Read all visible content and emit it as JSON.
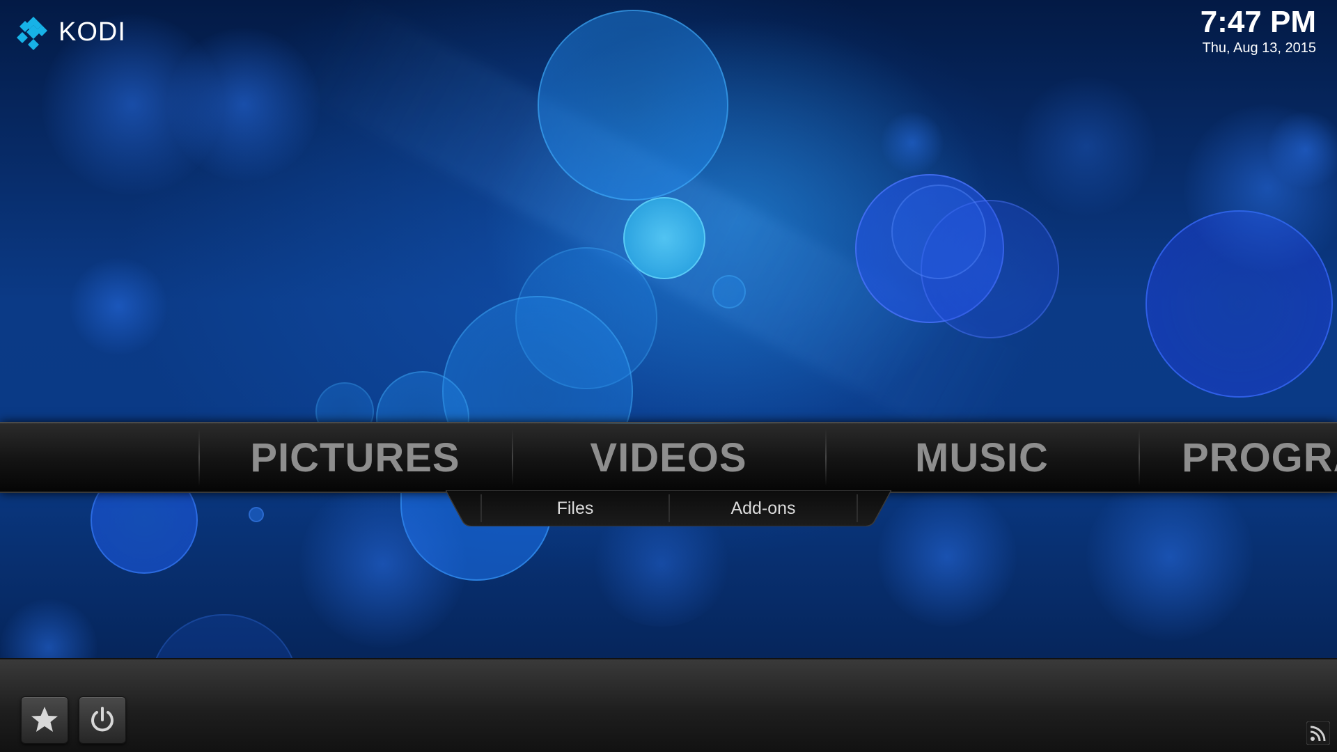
{
  "app": {
    "name": "KODI"
  },
  "header": {
    "time": "7:47 PM",
    "date": "Thu, Aug 13, 2015"
  },
  "main_menu": {
    "items": [
      {
        "label": "",
        "icon": "none"
      },
      {
        "label": "PICTURES"
      },
      {
        "label": "VIDEOS",
        "selected": true
      },
      {
        "label": "MUSIC"
      },
      {
        "label": "PROGRA"
      }
    ]
  },
  "submenu": {
    "items": [
      {
        "label": "Files"
      },
      {
        "label": "Add-ons"
      }
    ]
  },
  "bottom_bar": {
    "buttons": [
      {
        "name": "favourites",
        "icon": "star-icon"
      },
      {
        "name": "power",
        "icon": "power-icon"
      }
    ],
    "rss_icon": "rss-icon"
  },
  "colors": {
    "background": "#0b3a86",
    "menu_text": "#8e8e8e",
    "submenu_text": "#dcdcdc",
    "accent": "#3aa0f0",
    "logo_blue": "#17b2e7"
  }
}
